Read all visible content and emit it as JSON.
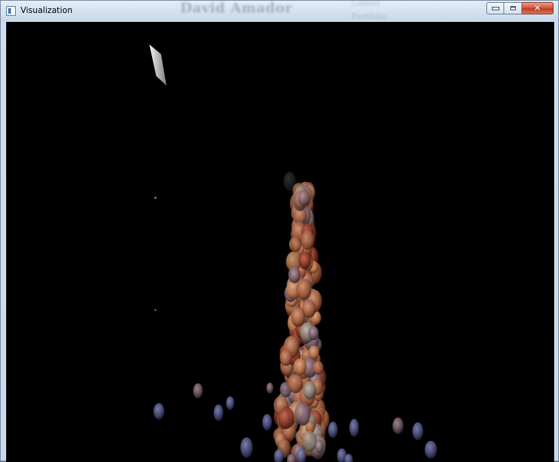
{
  "window": {
    "title": "Visualization",
    "controls": {
      "minimize": "minimize",
      "maximize": "maximize",
      "close": "close"
    }
  },
  "background_text": {
    "name": "David Amador",
    "line1": "Games",
    "line2": "Portfolio"
  },
  "colors": {
    "viewport": "#000000",
    "particle_warm": "#a05a3c",
    "particle_cool": "#4a4f7a"
  },
  "icons": {
    "app": "window-app-icon",
    "minimize": "minimize-icon",
    "maximize": "maximize-icon",
    "close": "close-icon"
  }
}
